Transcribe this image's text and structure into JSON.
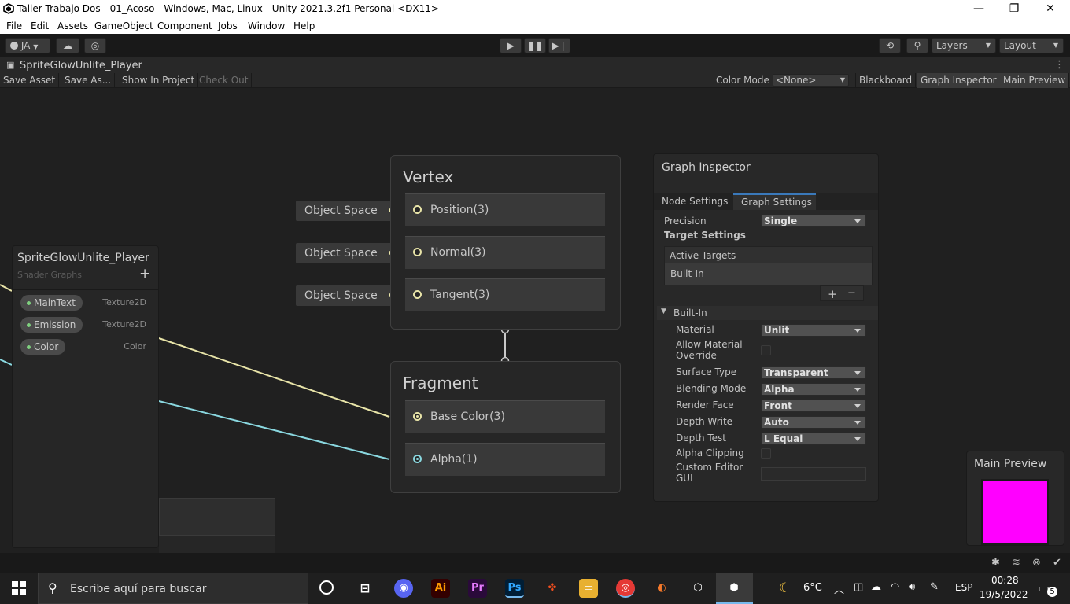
{
  "window": {
    "title": "Taller Trabajo Dos - 01_Acoso - Windows, Mac, Linux - Unity 2021.3.2f1 Personal <DX11>",
    "minimize": "—",
    "maximize": "❐",
    "close": "✕"
  },
  "menu": [
    "File",
    "Edit",
    "Assets",
    "GameObject",
    "Component",
    "Jobs",
    "Window",
    "Help"
  ],
  "toolbar": {
    "account": "JA",
    "layers": "Layers",
    "layout": "Layout"
  },
  "graph_tab": {
    "title": "SpriteGlowUnlite_Player",
    "save_asset": "Save Asset",
    "save_as": "Save As...",
    "show_in_project": "Show In Project",
    "check_out": "Check Out",
    "color_mode_label": "Color Mode",
    "color_mode_value": "<None>",
    "blackboard": "Blackboard",
    "graph_inspector": "Graph Inspector",
    "main_preview": "Main Preview"
  },
  "vertex": {
    "title": "Vertex",
    "blocks": [
      "Position(3)",
      "Normal(3)",
      "Tangent(3)"
    ],
    "inputs": [
      "Object Space",
      "Object Space",
      "Object Space"
    ]
  },
  "fragment": {
    "title": "Fragment",
    "blocks": [
      "Base Color(3)",
      "Alpha(1)"
    ]
  },
  "blackboard": {
    "title": "SpriteGlowUnlite_Player",
    "subtitle": "Shader Graphs",
    "add": "+",
    "properties": [
      {
        "name": "MainText",
        "type": "Texture2D"
      },
      {
        "name": "Emission",
        "type": "Texture2D"
      },
      {
        "name": "Color",
        "type": "Color"
      }
    ]
  },
  "inspector": {
    "title": "Graph Inspector",
    "tab_node": "Node Settings",
    "tab_graph": "Graph Settings",
    "precision_label": "Precision",
    "precision_value": "Single",
    "target_settings": "Target Settings",
    "active_targets": "Active Targets",
    "target_item": "Built-In",
    "plus": "+",
    "minus": "−",
    "section": "Built-In",
    "material_label": "Material",
    "material_value": "Unlit",
    "allow_override_1": "Allow Material",
    "allow_override_2": "Override",
    "surface_label": "Surface Type",
    "surface_value": "Transparent",
    "blend_label": "Blending Mode",
    "blend_value": "Alpha",
    "face_label": "Render Face",
    "face_value": "Front",
    "dwrite_label": "Depth Write",
    "dwrite_value": "Auto",
    "dtest_label": "Depth Test",
    "dtest_value": "L Equal",
    "clip_label": "Alpha Clipping",
    "custom_gui_1": "Custom Editor",
    "custom_gui_2": "GUI"
  },
  "preview": {
    "title": "Main Preview",
    "color": "#ff00ff"
  },
  "taskbar": {
    "search_placeholder": "Escribe aquí para buscar",
    "weather": "6°C",
    "lang": "ESP",
    "time": "00:28",
    "date": "19/5/2022",
    "notifications": "5"
  }
}
